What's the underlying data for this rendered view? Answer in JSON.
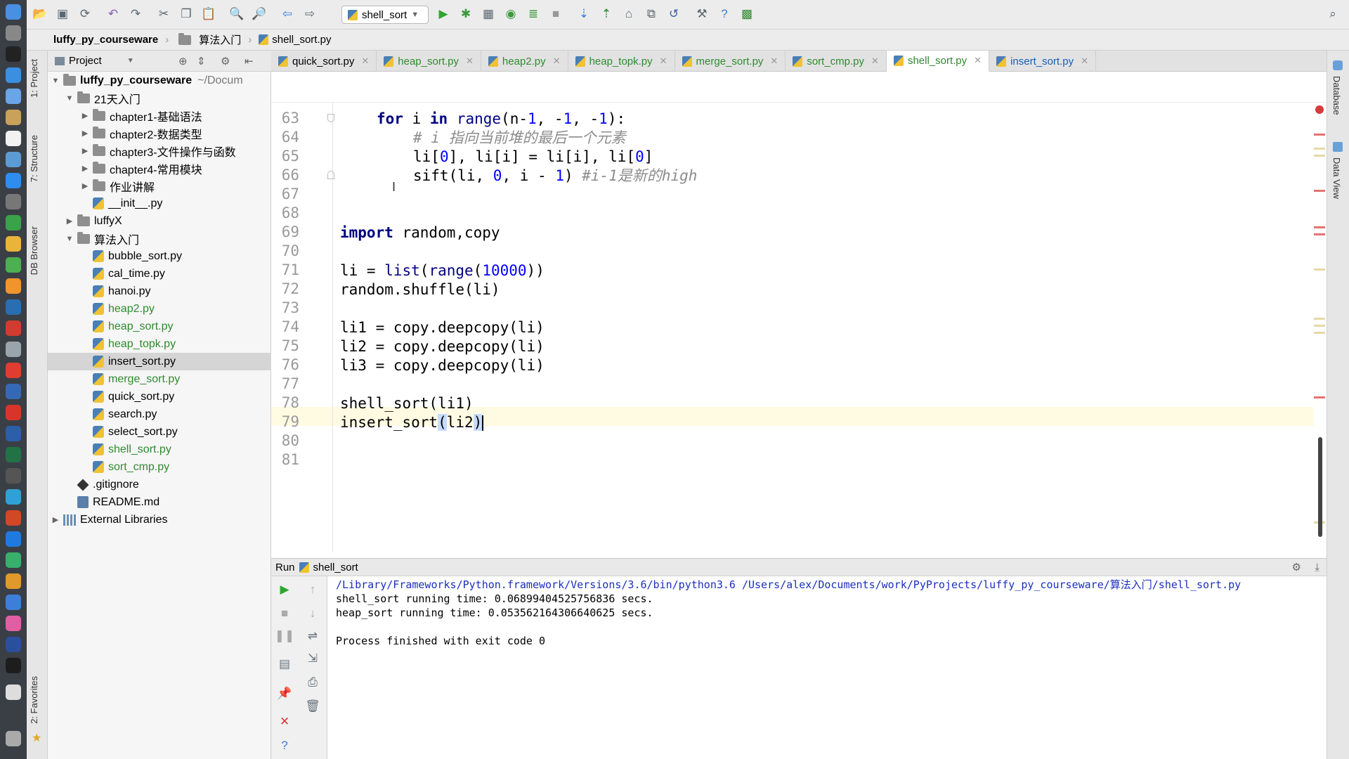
{
  "toolbar": {
    "run_config": "shell_sort"
  },
  "navbar": {
    "crumbs": [
      "luffy_py_courseware",
      "算法入门",
      "shell_sort.py"
    ]
  },
  "left_stripe": {
    "project": "1: Project",
    "structure": "7: Structure",
    "db_browser": "DB Browser",
    "favorites": "2: Favorites"
  },
  "right_panel": {
    "database": "Database",
    "data_view": "Data View"
  },
  "project": {
    "header": "Project",
    "tree": [
      {
        "label": "luffy_py_courseware",
        "suffix": "~/Docum"
      },
      {
        "label": "21天入门"
      },
      {
        "label": "chapter1-基础语法"
      },
      {
        "label": "chapter2-数据类型"
      },
      {
        "label": "chapter3-文件操作与函数"
      },
      {
        "label": "chapter4-常用模块"
      },
      {
        "label": "作业讲解"
      },
      {
        "label": "__init__.py"
      },
      {
        "label": "luffyX"
      },
      {
        "label": "算法入门"
      },
      {
        "label": "bubble_sort.py"
      },
      {
        "label": "cal_time.py"
      },
      {
        "label": "hanoi.py"
      },
      {
        "label": "heap2.py"
      },
      {
        "label": "heap_sort.py"
      },
      {
        "label": "heap_topk.py"
      },
      {
        "label": "insert_sort.py"
      },
      {
        "label": "merge_sort.py"
      },
      {
        "label": "quick_sort.py"
      },
      {
        "label": "search.py"
      },
      {
        "label": "select_sort.py"
      },
      {
        "label": "shell_sort.py"
      },
      {
        "label": "sort_cmp.py"
      },
      {
        "label": ".gitignore"
      },
      {
        "label": "README.md"
      },
      {
        "label": "External Libraries"
      }
    ]
  },
  "tabs": [
    {
      "label": "quick_sort.py"
    },
    {
      "label": "heap_sort.py"
    },
    {
      "label": "heap2.py"
    },
    {
      "label": "heap_topk.py"
    },
    {
      "label": "merge_sort.py"
    },
    {
      "label": "sort_cmp.py"
    },
    {
      "label": "shell_sort.py"
    },
    {
      "label": "insert_sort.py"
    }
  ],
  "editor": {
    "line_numbers": [
      "63",
      "64",
      "65",
      "66",
      "67",
      "68",
      "69",
      "70",
      "71",
      "72",
      "73",
      "74",
      "75",
      "76",
      "77",
      "78",
      "79",
      "80",
      "81"
    ],
    "code": {
      "l63_kw1": "for",
      "l63_a": " i ",
      "l63_kw2": "in",
      "l63_b": " ",
      "l63_bi": "range",
      "l63_c": "(n-",
      "l63_n1": "1",
      "l63_d": ", -",
      "l63_n2": "1",
      "l63_e": ", -",
      "l63_n3": "1",
      "l63_f": "):",
      "l64": "# i 指向当前堆的最后一个元素",
      "l65_a": "li[",
      "l65_n1": "0",
      "l65_b": "], li[i] = li[i], li[",
      "l65_n2": "0",
      "l65_c": "]",
      "l66_a": "sift(li, ",
      "l66_n1": "0",
      "l66_b": ", i - ",
      "l66_n2": "1",
      "l66_c": ") ",
      "l66_cm": "#i-1是新的high",
      "l69_kw": "import",
      "l69_a": " random,copy",
      "l71_a": "li = ",
      "l71_bi1": "list",
      "l71_b": "(",
      "l71_bi2": "range",
      "l71_c": "(",
      "l71_n": "10000",
      "l71_d": "))",
      "l72": "random.shuffle(li)",
      "l74": "li1 = copy.deepcopy(li)",
      "l75": "li2 = copy.deepcopy(li)",
      "l76": "li3 = copy.deepcopy(li)",
      "l78": "shell_sort(li1)",
      "l79_a": "insert_sort",
      "l79_b": "(",
      "l79_c": "li2",
      "l79_d": ")"
    }
  },
  "run": {
    "label": "Run",
    "config": "shell_sort",
    "console": [
      "/Library/Frameworks/Python.framework/Versions/3.6/bin/python3.6 /Users/alex/Documents/work/PyProjects/luffy_py_courseware/算法入门/shell_sort.py",
      "shell_sort running time: 0.06899404525756836 secs.",
      "heap_sort running time: 0.053562164306640625 secs.",
      "",
      "Process finished with exit code 0"
    ]
  },
  "colors": {
    "keyword": "#000080",
    "number": "#0000ff",
    "comment": "#8c8c8c",
    "vcs_added": "#2f8a2f",
    "current_line": "#fffbe3"
  }
}
